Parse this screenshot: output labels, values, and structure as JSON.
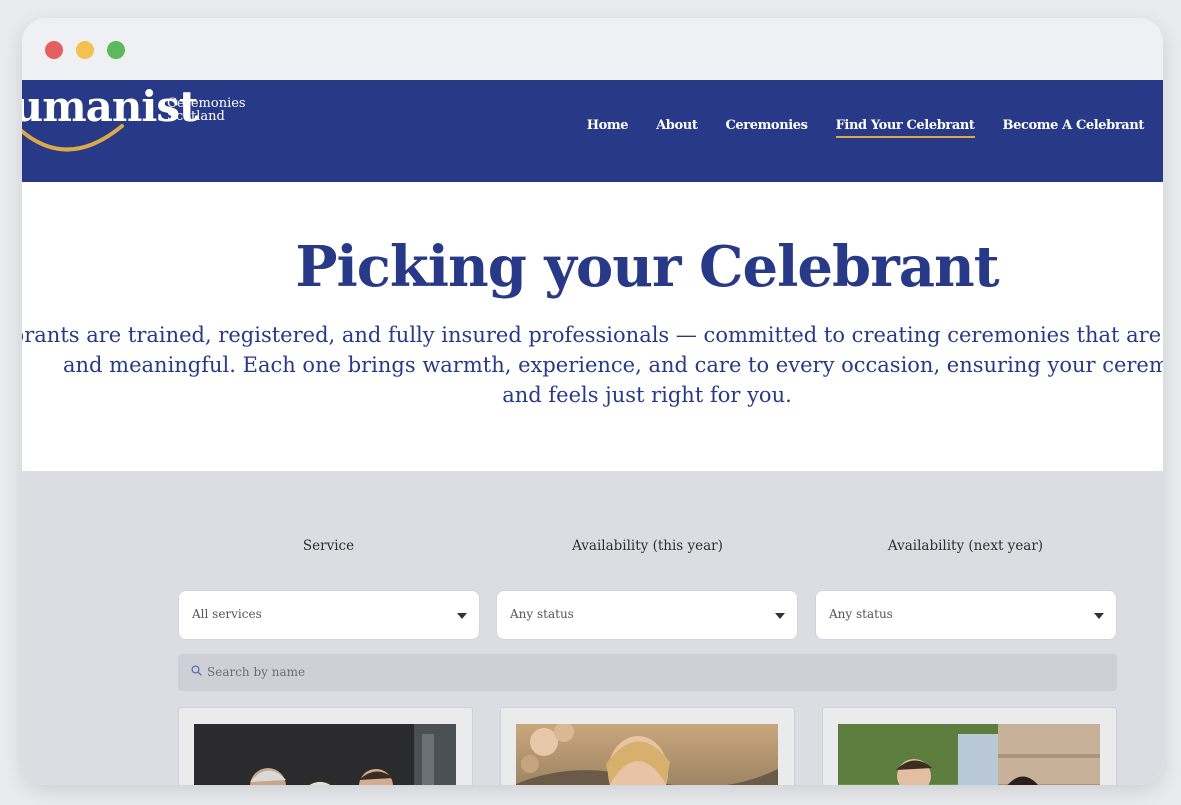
{
  "site": {
    "logo_word": "Humanist",
    "logo_sub_line1": "Ceremonies",
    "logo_sub_line2": "Scotland"
  },
  "nav": {
    "items": [
      {
        "label": "Home",
        "active": false
      },
      {
        "label": "About",
        "active": false
      },
      {
        "label": "Ceremonies",
        "active": false
      },
      {
        "label": "Find Your Celebrant",
        "active": true
      },
      {
        "label": "Become A Celebrant",
        "active": false
      }
    ]
  },
  "hero": {
    "title": "Picking your Celebrant",
    "text_line1": "Our celebrants are trained, registered, and fully insured professionals — committed to creating ceremonies that are personal, inclusive,",
    "text_line2": "and meaningful. Each one brings warmth, experience, and care to every occasion, ensuring your ceremony is",
    "text_line3": "and feels just right for you."
  },
  "filters": {
    "service": {
      "label": "Service",
      "value": "All services"
    },
    "availability_this_year": {
      "label": "Availability (this year)",
      "value": "Any status"
    },
    "availability_next_year": {
      "label": "Availability (next year)",
      "value": "Any status"
    },
    "search_placeholder": "Search by name"
  },
  "colors": {
    "brand_navy": "#283a87",
    "accent_gold": "#d9a94a",
    "finder_bg": "#dcdde2"
  }
}
